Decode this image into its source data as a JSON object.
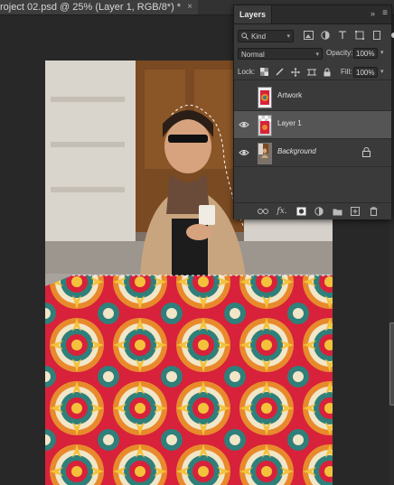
{
  "document_tab": {
    "title": "roject 02.psd @ 25% (Layer 1, RGB/8*) *",
    "close_glyph": "×"
  },
  "layers_panel": {
    "tab_label": "Layers",
    "collapse_glyph": "»",
    "menu_glyph": "≡",
    "filter_kind": "Kind",
    "blend_mode": "Normal",
    "opacity_label": "Opacity:",
    "opacity_value": "100%",
    "lock_label": "Lock:",
    "fill_label": "Fill:",
    "fill_value": "100%",
    "fx_label": "fx.",
    "layers": [
      {
        "name": "Artwork",
        "visible": false,
        "selected": false,
        "italic": false
      },
      {
        "name": "Layer 1",
        "visible": true,
        "selected": true,
        "italic": false
      },
      {
        "name": "Background",
        "visible": true,
        "selected": false,
        "italic": true,
        "locked": true
      }
    ]
  },
  "colors": {
    "accent_selected": "#555555",
    "panel_bg": "#3a3a3a",
    "canvas_bg": "#282828"
  }
}
